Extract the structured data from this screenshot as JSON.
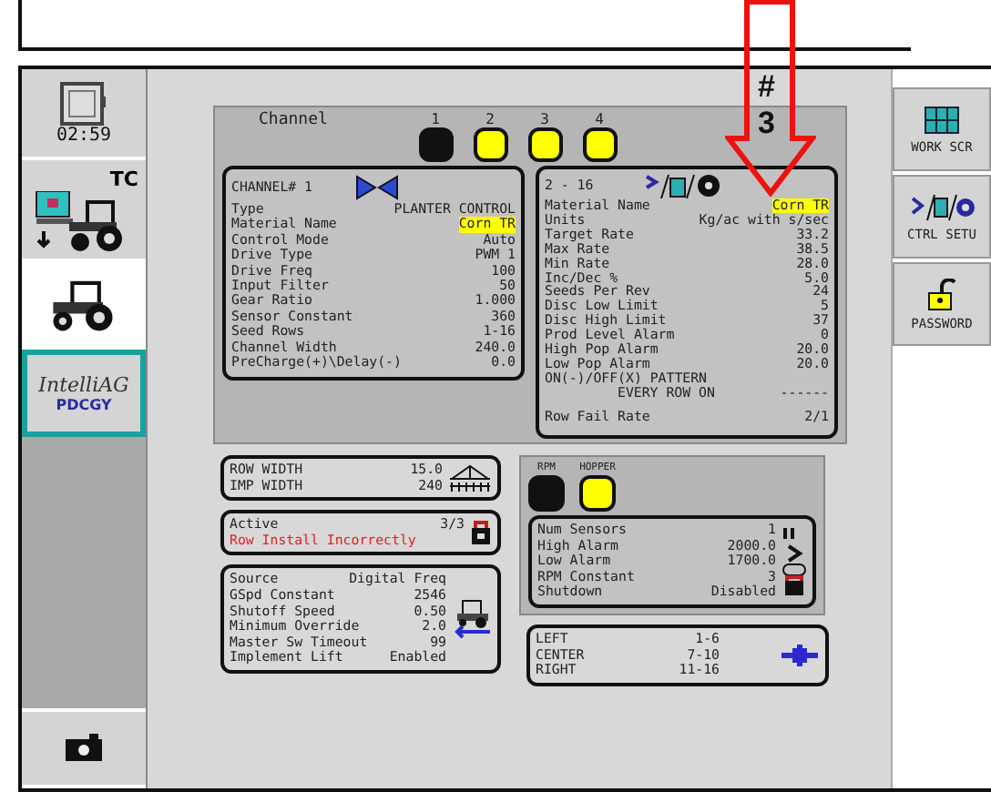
{
  "annotation": {
    "mark": "#",
    "number": "3"
  },
  "sidebar": {
    "clock": "02:59",
    "items": [
      {
        "kind": "tc",
        "label": "TC",
        "selected": false,
        "focused": false
      },
      {
        "kind": "tractor",
        "selected": true,
        "focused": false
      },
      {
        "kind": "intelliag",
        "label": "IntelliAG",
        "sublabel": "PDCGY",
        "selected": false,
        "focused": true
      }
    ]
  },
  "channel_bar": {
    "label": "Channel",
    "channels": [
      {
        "number": "1",
        "on": false
      },
      {
        "number": "2",
        "on": true
      },
      {
        "number": "3",
        "on": true
      },
      {
        "number": "4",
        "on": true
      }
    ]
  },
  "channel_box": {
    "title": "CHANNEL# 1",
    "rows": [
      {
        "label": "Type",
        "value": "PLANTER CONTROL",
        "highlighted": false
      },
      {
        "label": "Material Name",
        "value": "Corn TR",
        "highlighted": true
      },
      {
        "label": "Control Mode",
        "value": "Auto",
        "highlighted": false
      },
      {
        "label": "Drive Type",
        "value": "PWM 1",
        "highlighted": false
      },
      {
        "label": "Drive Freq",
        "value": "100",
        "highlighted": false
      },
      {
        "label": "Input Filter",
        "value": "50",
        "highlighted": false
      },
      {
        "label": "Gear Ratio",
        "value": "1.000",
        "highlighted": false
      },
      {
        "label": "Sensor Constant",
        "value": "360",
        "highlighted": false
      },
      {
        "label": "Seed Rows",
        "value": "1-16",
        "highlighted": false
      },
      {
        "label": "Channel Width",
        "value": "240.0",
        "highlighted": false
      },
      {
        "label": "PreCharge(+)\\Delay(-)",
        "value": "0.0",
        "highlighted": false
      }
    ]
  },
  "product_box": {
    "title": "2 - 16",
    "rows": [
      {
        "kind": "pair",
        "label": "Material Name",
        "value": "Corn TR",
        "highlighted": true
      },
      {
        "kind": "pair",
        "label": "Units",
        "value": "Kg/ac with s/sec",
        "highlighted": false
      },
      {
        "kind": "pair",
        "label": "Target Rate",
        "value": "33.2",
        "highlighted": false
      },
      {
        "kind": "pair",
        "label": "Max Rate",
        "value": "38.5",
        "highlighted": false
      },
      {
        "kind": "pair",
        "label": "Min Rate",
        "value": "28.0",
        "highlighted": false
      },
      {
        "kind": "pair",
        "label": "Inc/Dec %",
        "value": "5.0",
        "highlighted": false
      },
      {
        "kind": "pair",
        "label": "Seeds Per Rev",
        "value": "24",
        "highlighted": false
      },
      {
        "kind": "pair",
        "label": "Disc Low Limit",
        "value": "5",
        "highlighted": false
      },
      {
        "kind": "pair",
        "label": "Disc High Limit",
        "value": "37",
        "highlighted": false
      },
      {
        "kind": "pair",
        "label": "Prod Level Alarm",
        "value": "0",
        "highlighted": false
      },
      {
        "kind": "pair",
        "label": "High Pop Alarm",
        "value": "20.0",
        "highlighted": false
      },
      {
        "kind": "pair",
        "label": "Low Pop Alarm",
        "value": "20.0",
        "highlighted": false
      },
      {
        "kind": "heading",
        "label": "ON(-)/OFF(X) PATTERN",
        "highlighted": false
      },
      {
        "kind": "indent",
        "label": "EVERY ROW ON",
        "value": "------",
        "highlighted": false
      },
      {
        "kind": "spaced",
        "label": "Row Fail Rate",
        "value": "2/1",
        "highlighted": false
      }
    ]
  },
  "width_box": {
    "rows": [
      {
        "label": "ROW WIDTH",
        "value": "15.0"
      },
      {
        "label": "IMP WIDTH",
        "value": "240"
      }
    ]
  },
  "active_box": {
    "label": "Active",
    "value": "3/3",
    "warning": "Row Install Incorrectly"
  },
  "speed_box": {
    "rows": [
      {
        "label": "Source",
        "value": "Digital Freq"
      },
      {
        "label": "GSpd Constant",
        "value": "2546"
      },
      {
        "label": "Shutoff Speed",
        "value": "0.50"
      },
      {
        "label": "Minimum Override",
        "value": "2.0"
      },
      {
        "label": "Master Sw Timeout",
        "value": "99"
      },
      {
        "label": "Implement Lift",
        "value": "Enabled"
      }
    ]
  },
  "hopper": {
    "indicators": [
      {
        "label": "RPM",
        "on": false
      },
      {
        "label": "HOPPER",
        "on": true
      }
    ],
    "rows": [
      {
        "label": "Num Sensors",
        "value": "1"
      },
      {
        "label": "High Alarm",
        "value": "2000.0"
      },
      {
        "label": "Low Alarm",
        "value": "1700.0"
      },
      {
        "label": "RPM Constant",
        "value": "3"
      },
      {
        "label": "Shutdown",
        "value": "Disabled"
      }
    ]
  },
  "sections": [
    {
      "label": "LEFT",
      "value": "1-6"
    },
    {
      "label": "CENTER",
      "value": "7-10"
    },
    {
      "label": "RIGHT",
      "value": "11-16"
    }
  ],
  "right_buttons": [
    {
      "kind": "work",
      "label": "WORK SCR"
    },
    {
      "kind": "ctrl",
      "label": "CTRL SETU"
    },
    {
      "kind": "password",
      "label": "PASSWORD"
    }
  ]
}
